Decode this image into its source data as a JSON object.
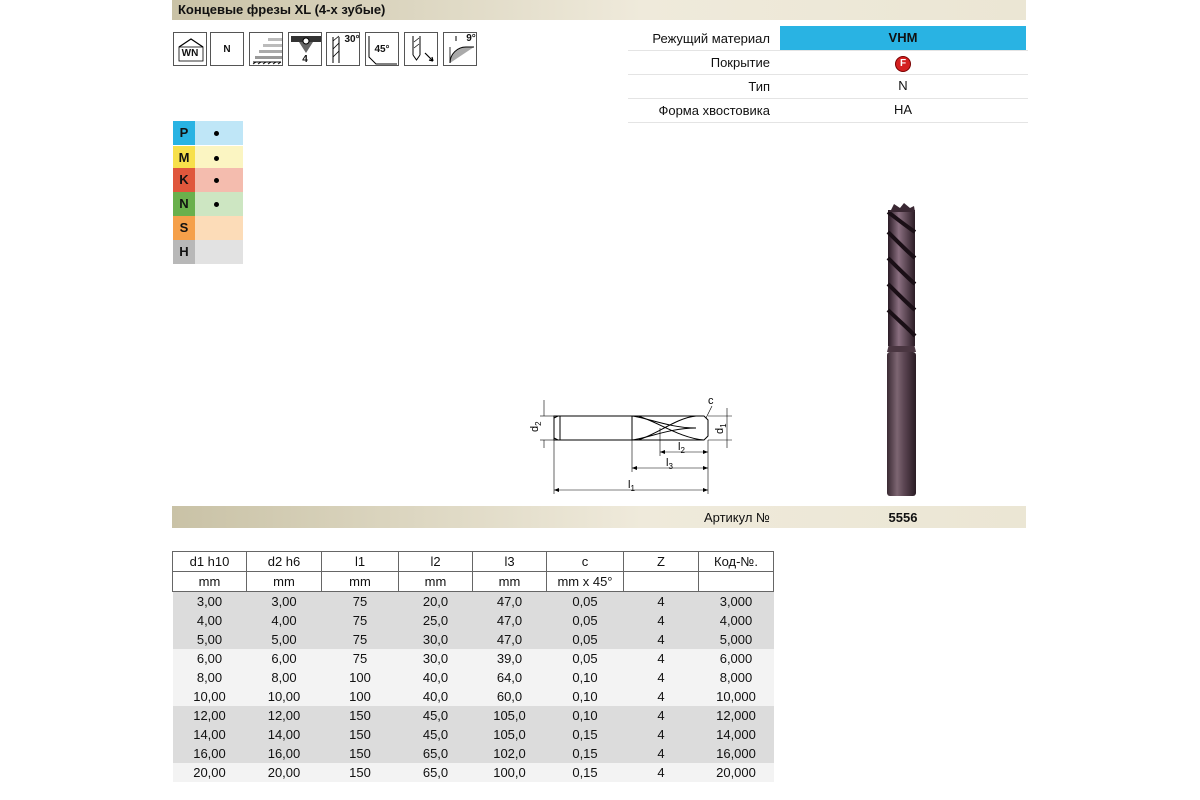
{
  "header": {
    "title": "Концевые фрезы XL (4-х зубые)"
  },
  "icons": [
    {
      "name": "wn-norm-icon",
      "label": "WN"
    },
    {
      "name": "type-n-icon",
      "label": "N"
    },
    {
      "name": "surface-finish-icon",
      "label": ""
    },
    {
      "name": "four-flutes-icon",
      "label": "4"
    },
    {
      "name": "helix-30-icon",
      "label": "30°"
    },
    {
      "name": "chamfer-45-icon",
      "label": "45°"
    },
    {
      "name": "plunge-feed-icon",
      "label": ""
    },
    {
      "name": "clearance-9-icon",
      "label": "9°"
    }
  ],
  "properties": {
    "cutting_material_label": "Режущий материал",
    "cutting_material_value": "VHM",
    "cutting_material_color": "#29b3e3",
    "coating_label": "Покрытие",
    "coating_badge": "F",
    "coating_color": "#d42020",
    "type_label": "Тип",
    "type_value": "N",
    "shank_label": "Форма хвостовика",
    "shank_value": "HA"
  },
  "materials": [
    {
      "letter": "P",
      "color": "#29b3e3",
      "bg": "#bfe6f7",
      "dot": true
    },
    {
      "letter": "M",
      "color": "#f7e04b",
      "bg": "#fbf5c2",
      "dot": true
    },
    {
      "letter": "K",
      "color": "#e0573c",
      "bg": "#f4bcae",
      "dot": true
    },
    {
      "letter": "N",
      "color": "#6ab04c",
      "bg": "#cde6c2",
      "dot": true
    },
    {
      "letter": "S",
      "color": "#f5a04a",
      "bg": "#fcdcb8",
      "dot": false
    },
    {
      "letter": "H",
      "color": "#b8b8b8",
      "bg": "#e2e2e2",
      "dot": false
    }
  ],
  "drawing_labels": {
    "d2": "d2",
    "d1": "d1",
    "c": "c",
    "l1": "l1",
    "l2": "l2",
    "l3": "l3"
  },
  "article": {
    "label": "Артикул №",
    "value": "5556"
  },
  "table": {
    "headers": [
      "d1 h10",
      "d2 h6",
      "l1",
      "l2",
      "l3",
      "c",
      "Z",
      "Код-№."
    ],
    "units": [
      "mm",
      "mm",
      "mm",
      "mm",
      "mm",
      "mm x 45°",
      "",
      ""
    ],
    "rows": [
      [
        "3,00",
        "3,00",
        "75",
        "20,0",
        "47,0",
        "0,05",
        "4",
        "3,000"
      ],
      [
        "4,00",
        "4,00",
        "75",
        "25,0",
        "47,0",
        "0,05",
        "4",
        "4,000"
      ],
      [
        "5,00",
        "5,00",
        "75",
        "30,0",
        "47,0",
        "0,05",
        "4",
        "5,000"
      ],
      [
        "6,00",
        "6,00",
        "75",
        "30,0",
        "39,0",
        "0,05",
        "4",
        "6,000"
      ],
      [
        "8,00",
        "8,00",
        "100",
        "40,0",
        "64,0",
        "0,10",
        "4",
        "8,000"
      ],
      [
        "10,00",
        "10,00",
        "100",
        "40,0",
        "60,0",
        "0,10",
        "4",
        "10,000"
      ],
      [
        "12,00",
        "12,00",
        "150",
        "45,0",
        "105,0",
        "0,10",
        "4",
        "12,000"
      ],
      [
        "14,00",
        "14,00",
        "150",
        "45,0",
        "105,0",
        "0,15",
        "4",
        "14,000"
      ],
      [
        "16,00",
        "16,00",
        "150",
        "65,0",
        "102,0",
        "0,15",
        "4",
        "16,000"
      ],
      [
        "20,00",
        "20,00",
        "150",
        "65,0",
        "100,0",
        "0,15",
        "4",
        "20,000"
      ]
    ]
  }
}
